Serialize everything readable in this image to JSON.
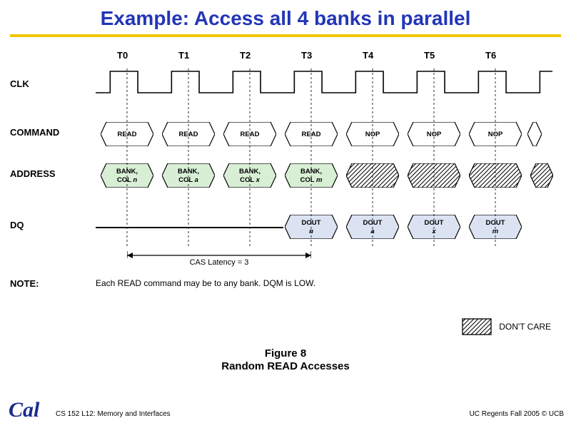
{
  "title": "Example: Access all 4 banks in parallel",
  "ticks": [
    "T0",
    "T1",
    "T2",
    "T3",
    "T4",
    "T5",
    "T6"
  ],
  "labels": {
    "clk": "CLK",
    "command": "COMMAND",
    "address": "ADDRESS",
    "dq": "DQ",
    "note": "NOTE:"
  },
  "command_cells": [
    "READ",
    "READ",
    "READ",
    "READ",
    "NOP",
    "NOP",
    "NOP"
  ],
  "address_cells": [
    {
      "l1": "BANK,",
      "l2": "COL n",
      "style": "green"
    },
    {
      "l1": "BANK,",
      "l2": "COL a",
      "style": "green"
    },
    {
      "l1": "BANK,",
      "l2": "COL x",
      "style": "green"
    },
    {
      "l1": "BANK,",
      "l2": "COL m",
      "style": "green"
    },
    {
      "style": "hatch"
    },
    {
      "style": "hatch"
    },
    {
      "style": "hatch"
    },
    {
      "style": "hatch",
      "narrow": true
    }
  ],
  "dq_cells": [
    {
      "l1": "DOUT",
      "l2": "n"
    },
    {
      "l1": "DOUT",
      "l2": "a"
    },
    {
      "l1": "DOUT",
      "l2": "x"
    },
    {
      "l1": "DOUT",
      "l2": "m"
    }
  ],
  "dq_start_index": 3,
  "cas_label": "CAS Latency = 3",
  "note_text": "Each READ command may be to any bank. DQM is LOW.",
  "legend_text": "DON'T CARE",
  "figure": {
    "num": "Figure 8",
    "title": "Random READ Accesses"
  },
  "footer": {
    "left": "CS 152 L12: Memory and Interfaces",
    "right": "UC Regents Fall 2005 © UCB"
  },
  "logo": "Cal",
  "chart_data": {
    "type": "timing-diagram",
    "clock_cycles": [
      "T0",
      "T1",
      "T2",
      "T3",
      "T4",
      "T5",
      "T6"
    ],
    "signals": [
      {
        "name": "CLK",
        "type": "clock"
      },
      {
        "name": "COMMAND",
        "type": "bus",
        "values": [
          "READ",
          "READ",
          "READ",
          "READ",
          "NOP",
          "NOP",
          "NOP"
        ]
      },
      {
        "name": "ADDRESS",
        "type": "bus",
        "values": [
          "BANK, COL n",
          "BANK, COL a",
          "BANK, COL x",
          "BANK, COL m",
          "X",
          "X",
          "X"
        ]
      },
      {
        "name": "DQ",
        "type": "bus",
        "values": [
          null,
          null,
          null,
          "DOUT n",
          "DOUT a",
          "DOUT x",
          "DOUT m"
        ]
      }
    ],
    "annotations": [
      {
        "text": "CAS Latency = 3",
        "from": "T0",
        "to": "T3"
      }
    ],
    "title": "Random READ Accesses"
  }
}
